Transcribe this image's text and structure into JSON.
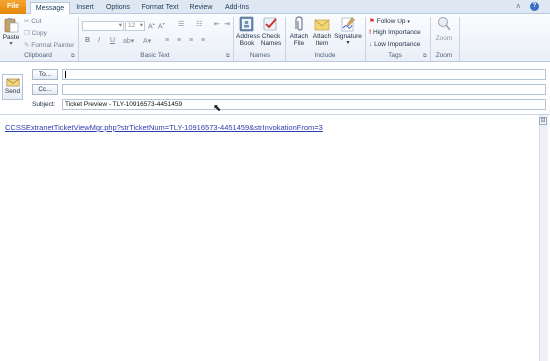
{
  "tabs": [
    "File",
    "Message",
    "Insert",
    "Options",
    "Format Text",
    "Review",
    "Add-Ins"
  ],
  "window_controls": {
    "help": "?",
    "collapse": "˄"
  },
  "clipboard": {
    "label": "Clipboard",
    "paste": "Paste",
    "cut": "Cut",
    "copy": "Copy",
    "format_painter": "Format Painter"
  },
  "basic_text": {
    "label": "Basic Text",
    "font_size": "12",
    "bold": "B",
    "italic": "I",
    "underline": "U"
  },
  "names": {
    "label": "Names",
    "address_book": [
      "Address",
      "Book"
    ],
    "check_names": [
      "Check",
      "Names"
    ]
  },
  "include": {
    "label": "Include",
    "attach_file": [
      "Attach",
      "File"
    ],
    "attach_item": [
      "Attach",
      "Item"
    ],
    "signature": "Signature"
  },
  "tags": {
    "label": "Tags",
    "follow_up": "Follow Up",
    "high_importance": "High Importance",
    "low_importance": "Low Importance"
  },
  "zoom": {
    "label": "Zoom",
    "button": "Zoom"
  },
  "compose": {
    "send": "Send",
    "to_button": "To...",
    "cc_button": "Cc...",
    "subject_label": "Subject:",
    "to_value": "",
    "cc_value": "",
    "subject_value": "Ticket Preview - TLY-10916573-4451459"
  },
  "body": {
    "link": "CCSSExtranetTicketViewMgr.php?strTicketNum=TLY-10916573-4451459&strInvokationFrom=3"
  },
  "colors": {
    "file_tab": "#e5860a",
    "link": "#2c3fae",
    "ribbon_bg": "#e9eff7",
    "flag_red": "#d22b2b",
    "importance_blue": "#2b56c4"
  }
}
